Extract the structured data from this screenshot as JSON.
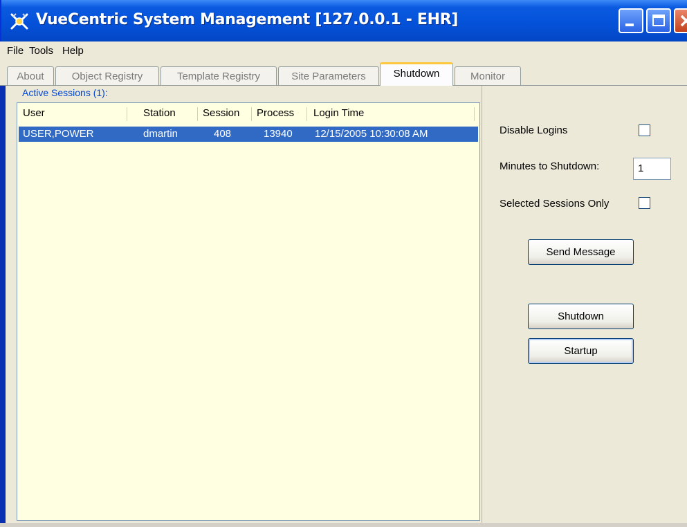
{
  "window": {
    "title": "VueCentric System Management  [127.0.0.1 - EHR]"
  },
  "menubar": {
    "items": [
      "File",
      "Tools",
      "Help"
    ]
  },
  "tabs": [
    {
      "label": "About"
    },
    {
      "label": "Object Registry"
    },
    {
      "label": "Template Registry"
    },
    {
      "label": "Site Parameters"
    },
    {
      "label": "Shutdown",
      "active": true
    },
    {
      "label": "Monitor"
    }
  ],
  "sessions": {
    "group_label": "Active Sessions (1):",
    "columns": [
      "User",
      "Station",
      "Session",
      "Process",
      "Login Time"
    ],
    "rows": [
      {
        "user": "USER,POWER",
        "station": "dmartin",
        "session": "408",
        "process": "13940",
        "login_time": "12/15/2005 10:30:08 AM"
      }
    ]
  },
  "controls": {
    "disable_logins_label": "Disable Logins",
    "disable_logins_checked": false,
    "minutes_label": "Minutes to Shutdown:",
    "minutes_value": "1",
    "selected_only_label": "Selected Sessions Only",
    "selected_only_checked": false,
    "send_message_label": "Send Message",
    "shutdown_label": "Shutdown",
    "startup_label": "Startup"
  },
  "colors": {
    "titlebar": "#0451d8",
    "selection": "#316ac5",
    "list_bg": "#ffffe1",
    "group_label": "#0046d5"
  }
}
